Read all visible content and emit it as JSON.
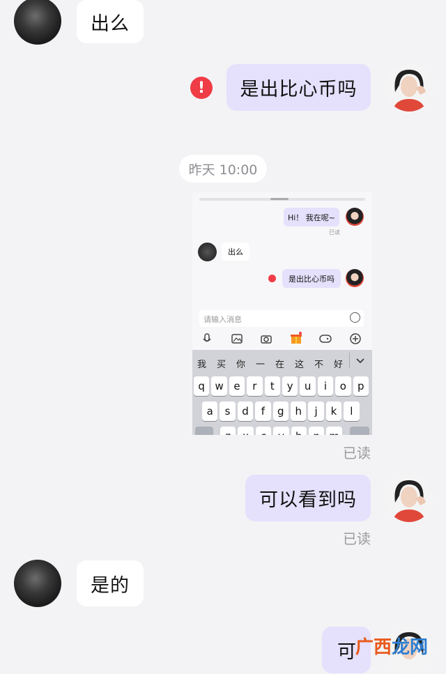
{
  "messages": {
    "m1": "出么",
    "m2": "是出比心币吗",
    "m3_time": "昨天 10:00",
    "m4_read": "已读",
    "m5": "可以看到吗",
    "m5_read": "已读",
    "m6": "是的",
    "m7": "可"
  },
  "embedded": {
    "msg1": "Hi！ 我在呢~",
    "msg1_read": "已读",
    "msg2": "出么",
    "msg3": "是出比心币吗",
    "input_placeholder": "请输入消息",
    "candidates": [
      "我",
      "买",
      "你",
      "一",
      "在",
      "这",
      "不",
      "好"
    ],
    "keyboard_row1": [
      "q",
      "w",
      "e",
      "r",
      "t",
      "y",
      "u",
      "i",
      "o",
      "p"
    ],
    "keyboard_row2": [
      "a",
      "s",
      "d",
      "f",
      "g",
      "h",
      "j",
      "k",
      "l"
    ],
    "keyboard_row3": [
      "z",
      "x",
      "c",
      "v",
      "b",
      "n",
      "m"
    ]
  },
  "icons": {
    "error": "!",
    "chevron": "⌄"
  },
  "watermark": {
    "part1": "广",
    "part2": "西",
    "part3": "龙网"
  },
  "colors": {
    "bubble_right": "#e5e0fb",
    "bubble_left": "#ffffff",
    "error": "#ef3c46",
    "background": "#f3f3f6"
  }
}
